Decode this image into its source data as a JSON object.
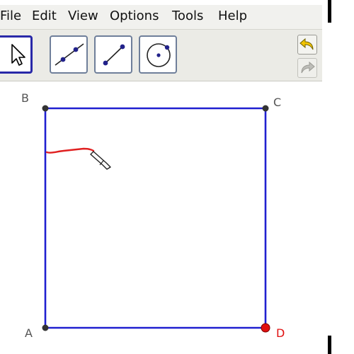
{
  "menu": {
    "file": "File",
    "edit": "Edit",
    "view": "View",
    "options": "Options",
    "tools": "Tools",
    "help": "Help"
  },
  "toolbar": {
    "tools": [
      {
        "icon": "pointer-icon",
        "selected": true
      },
      {
        "icon": "line-through-points-icon",
        "selected": false
      },
      {
        "icon": "segment-icon",
        "selected": false
      },
      {
        "icon": "circle-with-center-icon",
        "selected": false
      }
    ],
    "undo_icon": "undo-arrow-icon",
    "redo_icon": "redo-arrow-icon"
  },
  "drawing": {
    "points": {
      "A": "A",
      "B": "B",
      "C": "C",
      "D": "D"
    },
    "colors": {
      "square_edge": "#2020d0",
      "point": "#333333",
      "selected_point": "#e01010",
      "pen_stroke": "#e02020"
    },
    "cursor_icon": "pen-cursor-icon"
  }
}
